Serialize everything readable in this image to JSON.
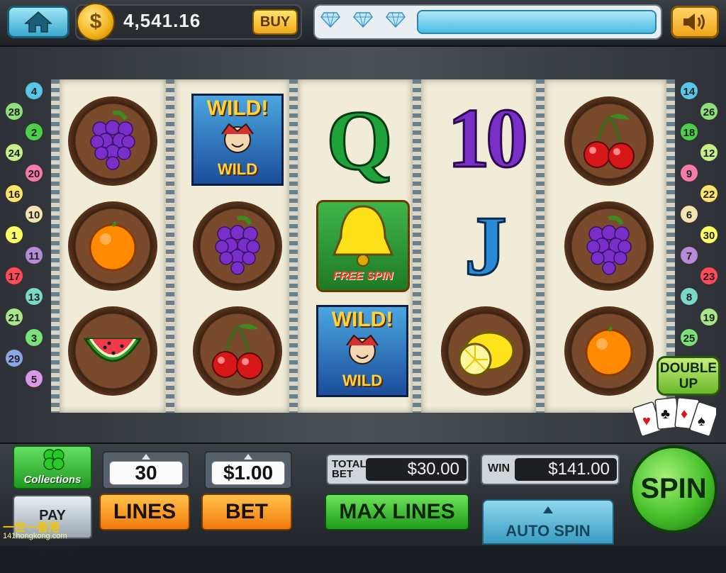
{
  "top_bar": {
    "balance": "4,541.16",
    "buy_label": "BUY",
    "coin_symbol": "$",
    "xp_diamonds": 3,
    "home_icon": "home-icon",
    "sound_icon": "speaker-icon"
  },
  "reels": [
    [
      "grapes",
      "orange",
      "watermelon"
    ],
    [
      "wild",
      "grapes",
      "cherries"
    ],
    [
      "Q",
      "bell-free-spin",
      "wild"
    ],
    [
      "10",
      "J",
      "lemon"
    ],
    [
      "cherries",
      "grapes",
      "orange"
    ]
  ],
  "symbol_text": {
    "wild_top": "WILD!",
    "wild_bottom": "WILD",
    "free_spin": "FREE SPIN",
    "q": "Q",
    "ten": "10",
    "j": "J"
  },
  "left_lines": [
    "4",
    "28",
    "2",
    "24",
    "20",
    "16",
    "10",
    "1",
    "11",
    "17",
    "13",
    "21",
    "3",
    "29",
    "5"
  ],
  "right_lines": [
    "14",
    "26",
    "18",
    "12",
    "9",
    "22",
    "6",
    "30",
    "7",
    "23",
    "8",
    "19",
    "25"
  ],
  "double_up": {
    "line1": "DOUBLE",
    "line2": "UP"
  },
  "bottom": {
    "collections_label": "Collections",
    "paytable_label": "PAY TABLE",
    "lines_value": "30",
    "bet_value": "$1.00",
    "lines_label": "LINES",
    "bet_label": "BET",
    "max_lines_label": "MAX LINES",
    "total_bet_label_1": "TOTAL",
    "total_bet_label_2": "BET",
    "total_bet_value": "$30.00",
    "win_label": "WIN",
    "win_value": "$141.00",
    "auto_spin_label": "AUTO SPIN",
    "spin_label": "SPIN"
  },
  "watermark": {
    "line1": "一世一香港",
    "line2": "141hongkong.com"
  },
  "colors": {
    "accent_blue": "#49bde4",
    "gold": "#f0a91a",
    "green": "#1e9a1a",
    "orange": "#f07a0c"
  }
}
